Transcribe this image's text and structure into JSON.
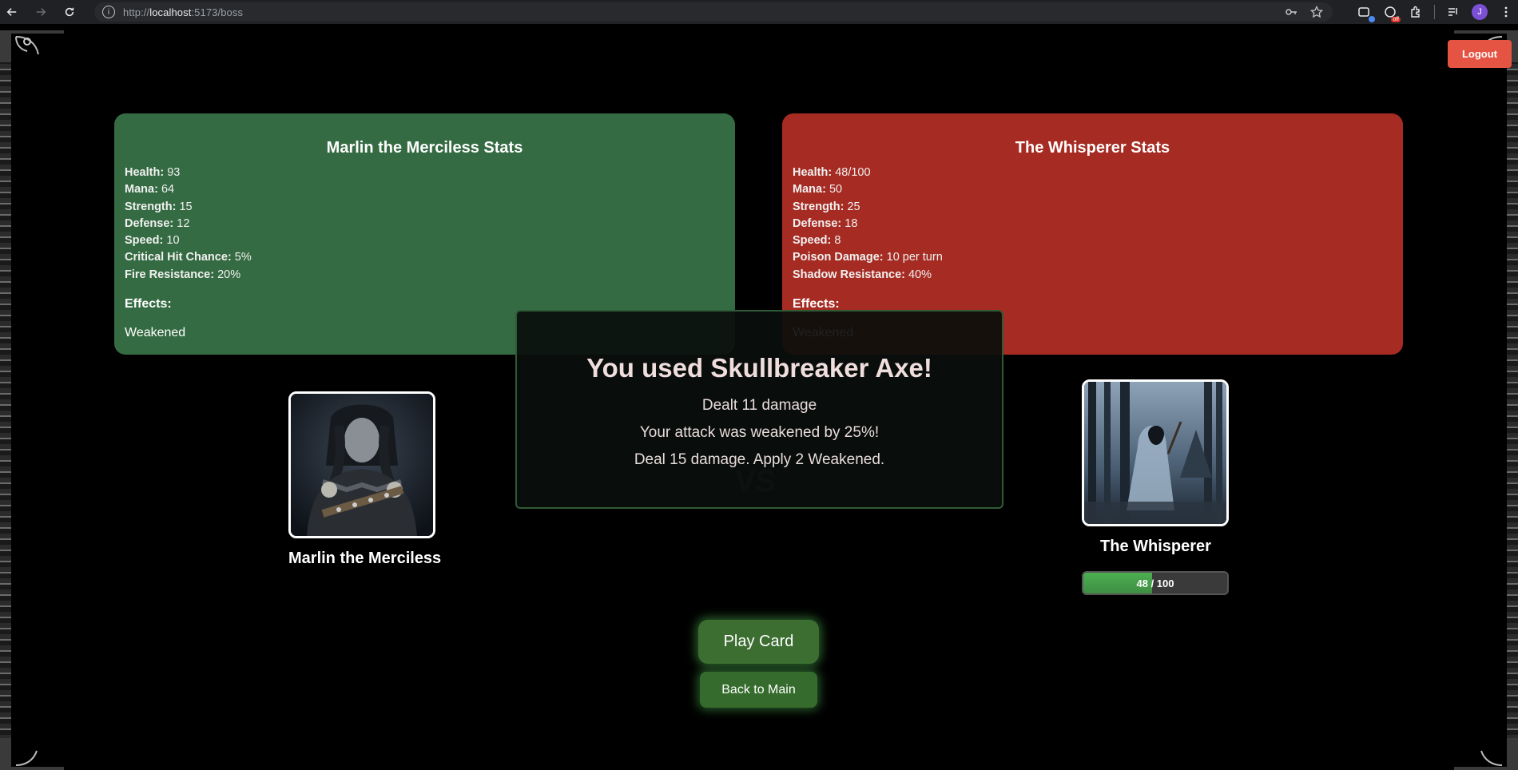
{
  "browser": {
    "url_prefix": "http://",
    "url_host": "localhost",
    "url_rest": ":5173/boss",
    "avatar_initial": "J",
    "ext_badge": "off"
  },
  "header": {
    "logout_label": "Logout"
  },
  "player": {
    "stats_title": "Marlin the Merciless Stats",
    "name": "Marlin the Merciless",
    "stats": [
      {
        "label": "Health:",
        "value": "93"
      },
      {
        "label": "Mana:",
        "value": "64"
      },
      {
        "label": "Strength:",
        "value": "15"
      },
      {
        "label": "Defense:",
        "value": "12"
      },
      {
        "label": "Speed:",
        "value": "10"
      },
      {
        "label": "Critical Hit Chance:",
        "value": "5%"
      },
      {
        "label": "Fire Resistance:",
        "value": "20%"
      }
    ],
    "effects_label": "Effects:",
    "effects": [
      "Weakened"
    ]
  },
  "boss": {
    "stats_title": "The Whisperer Stats",
    "name": "The Whisperer",
    "stats": [
      {
        "label": "Health:",
        "value": "48/100"
      },
      {
        "label": "Mana:",
        "value": "50"
      },
      {
        "label": "Strength:",
        "value": "25"
      },
      {
        "label": "Defense:",
        "value": "18"
      },
      {
        "label": "Speed:",
        "value": "8"
      },
      {
        "label": "Poison Damage:",
        "value": "10 per turn"
      },
      {
        "label": "Shadow Resistance:",
        "value": "40%"
      }
    ],
    "effects_label": "Effects:",
    "effects": [
      "Weakened"
    ],
    "health_text": "48 / 100",
    "health_fraction": 0.48
  },
  "vs_label": "VS",
  "modal": {
    "title": "You used Skullbreaker Axe!",
    "lines": [
      "Dealt 11 damage",
      "Your attack was weakened by 25%!",
      "Deal 15 damage. Apply 2 Weakened."
    ]
  },
  "actions": {
    "play_card_label": "Play Card",
    "back_label": "Back to Main"
  },
  "colors": {
    "player_panel": "#356b42",
    "boss_panel": "#a62b22",
    "logout": "#e55443",
    "health_fill": "#4caf50"
  }
}
